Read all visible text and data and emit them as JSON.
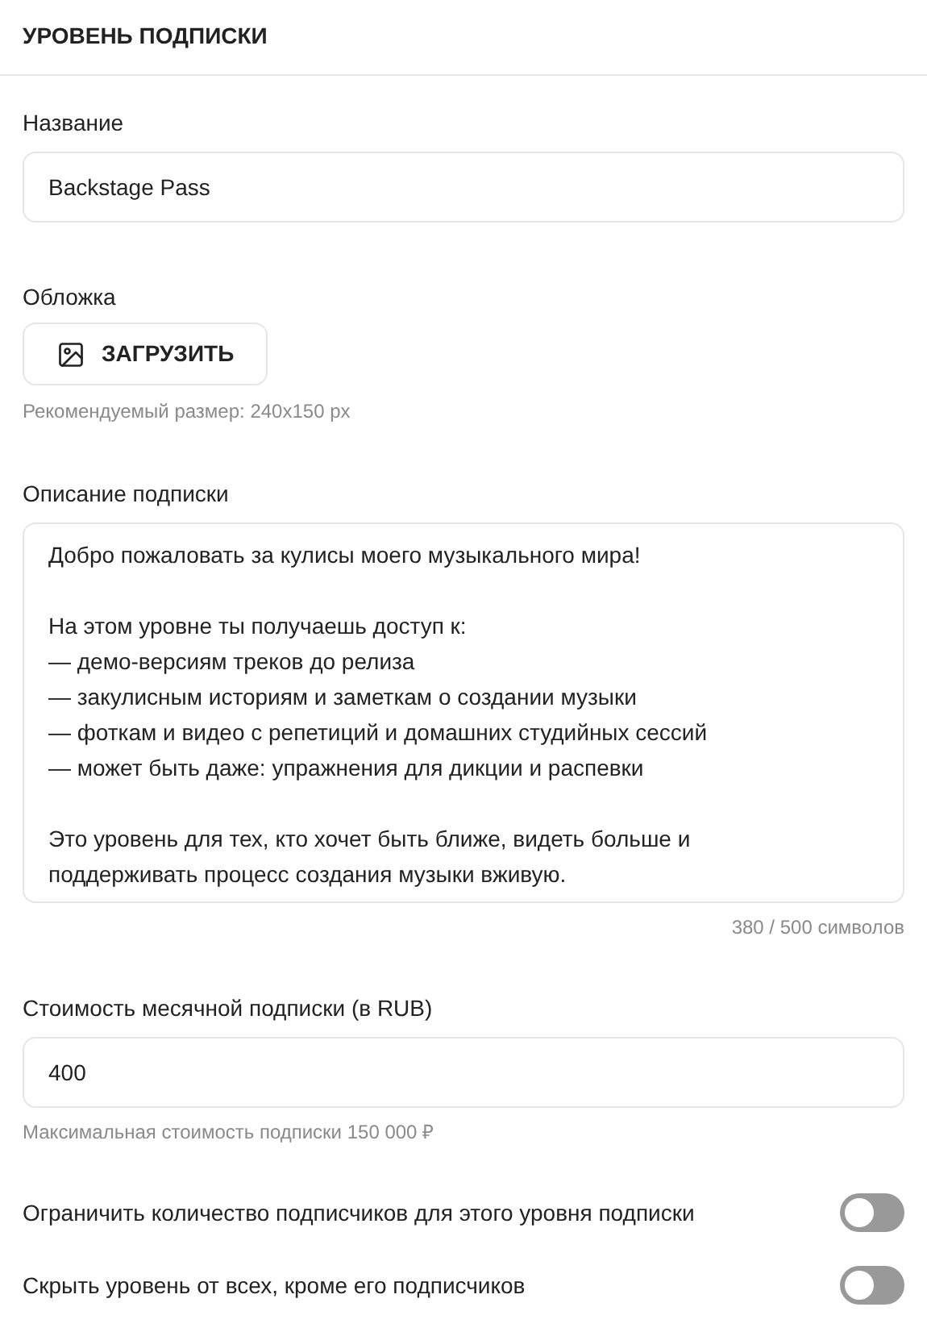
{
  "header": {
    "title": "УРОВЕНЬ ПОДПИСКИ"
  },
  "name_field": {
    "label": "Название",
    "value": "Backstage Pass"
  },
  "cover": {
    "label": "Обложка",
    "button": "ЗАГРУЗИТЬ",
    "hint": "Рекомендуемый размер: 240x150 px"
  },
  "description": {
    "label": "Описание подписки",
    "paragraphs": [
      [
        "Добро пожаловать за кулисы моего музыкального мира!"
      ],
      [
        "На этом уровне ты получаешь доступ к:",
        "— демо-версиям треков до релиза",
        "— закулисным историям и заметкам о создании музыки",
        "— фоткам и видео с репетиций и домашних студийных сессий",
        "— может быть даже: упражнения для дикции и распевки"
      ],
      [
        "Это уровень для тех, кто хочет быть ближе, видеть больше и",
        "поддерживать процесс создания музыки вживую."
      ]
    ],
    "counter": "380 / 500 символов"
  },
  "price": {
    "label": "Стоимость месячной подписки (в RUB)",
    "value": "400",
    "hint": "Максимальная стоимость подписки 150 000 ₽"
  },
  "toggles": [
    {
      "label": "Ограничить количество подписчиков для этого уровня подписки",
      "on": false
    },
    {
      "label": "Скрыть уровень от всех, кроме его подписчиков",
      "on": false
    }
  ]
}
